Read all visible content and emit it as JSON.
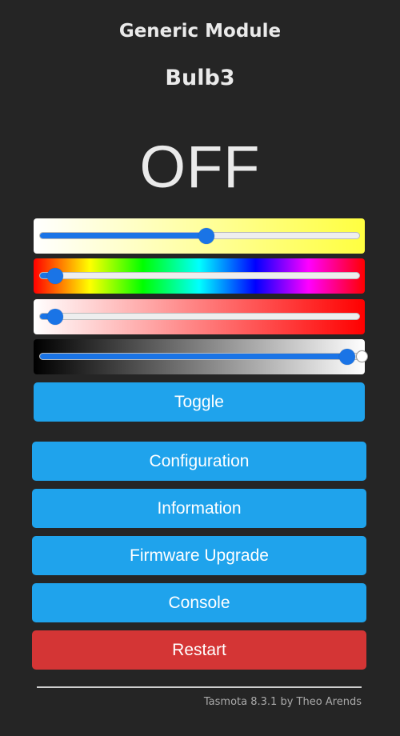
{
  "header": {
    "module_title": "Generic Module",
    "device_name": "Bulb3"
  },
  "power": {
    "state": "OFF"
  },
  "sliders": [
    {
      "name": "color-temperature",
      "value": 0.52,
      "hollow_thumb": false
    },
    {
      "name": "hue",
      "value": 0.05,
      "hollow_thumb": false
    },
    {
      "name": "saturation",
      "value": 0.05,
      "hollow_thumb": false
    },
    {
      "name": "dimmer",
      "value": 0.96,
      "hollow_thumb": true
    }
  ],
  "buttons": {
    "toggle": "Toggle",
    "configuration": "Configuration",
    "information": "Information",
    "firmware_upgrade": "Firmware Upgrade",
    "console": "Console",
    "restart": "Restart"
  },
  "footer": {
    "text": "Tasmota 8.3.1 by Theo Arends"
  },
  "colors": {
    "background": "#252525",
    "button_blue": "#1fa3ec",
    "button_red": "#d43535",
    "slider_accent": "#1a74e6"
  }
}
